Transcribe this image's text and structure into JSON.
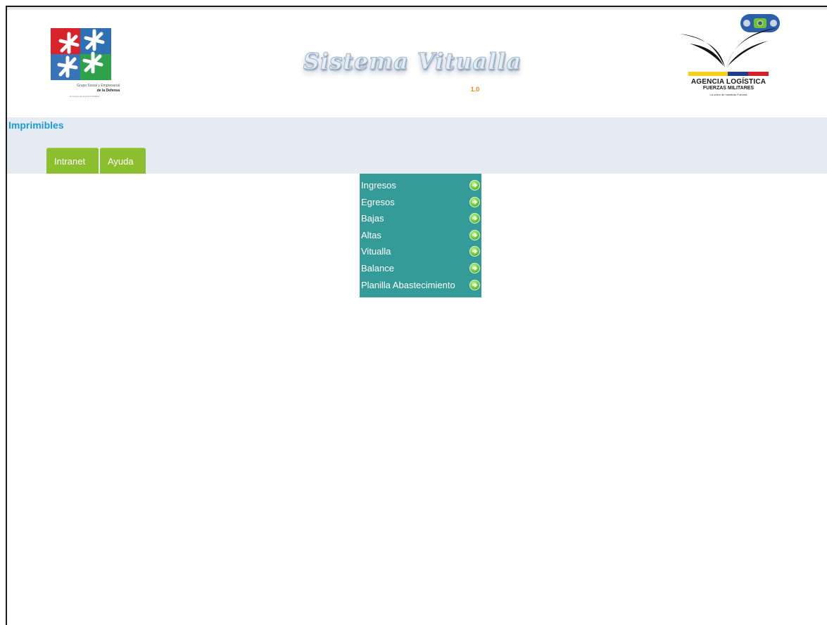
{
  "header": {
    "left_logo": {
      "caption_line1": "Grupo Social y Empresarial",
      "caption_line2": "de la Defensa",
      "caption_line3": "Al servicio de la Fuerza Pública"
    },
    "title": "Sistema Vitualla",
    "version": "1.0",
    "right_logo": {
      "name_line1": "AGENCIA LOGÍSTICA",
      "name_line2": "FUERZAS MILITARES",
      "tagline": "La unión de nuestras Fuerzas"
    }
  },
  "section": {
    "title": "Imprimibles"
  },
  "tabs": [
    {
      "label": "Intranet"
    },
    {
      "label": "Ayuda"
    }
  ],
  "menu": {
    "items": [
      {
        "label": "Ingresos",
        "icon": "arrow-right-icon"
      },
      {
        "label": "Egresos",
        "icon": "arrow-right-icon"
      },
      {
        "label": "Bajas",
        "icon": "arrow-right-icon"
      },
      {
        "label": "Altas",
        "icon": "arrow-right-icon"
      },
      {
        "label": "Vitualla",
        "icon": "arrow-right-icon"
      },
      {
        "label": "Balance",
        "icon": "arrow-right-icon"
      },
      {
        "label": "Planilla Abastecimiento",
        "icon": "arrow-right-icon"
      }
    ]
  },
  "colors": {
    "band": "#e4ebf3",
    "section_title": "#1e9bd6",
    "tab": "#8cbf2f",
    "menu_bg": "#349b98",
    "version": "#f08a1c"
  }
}
